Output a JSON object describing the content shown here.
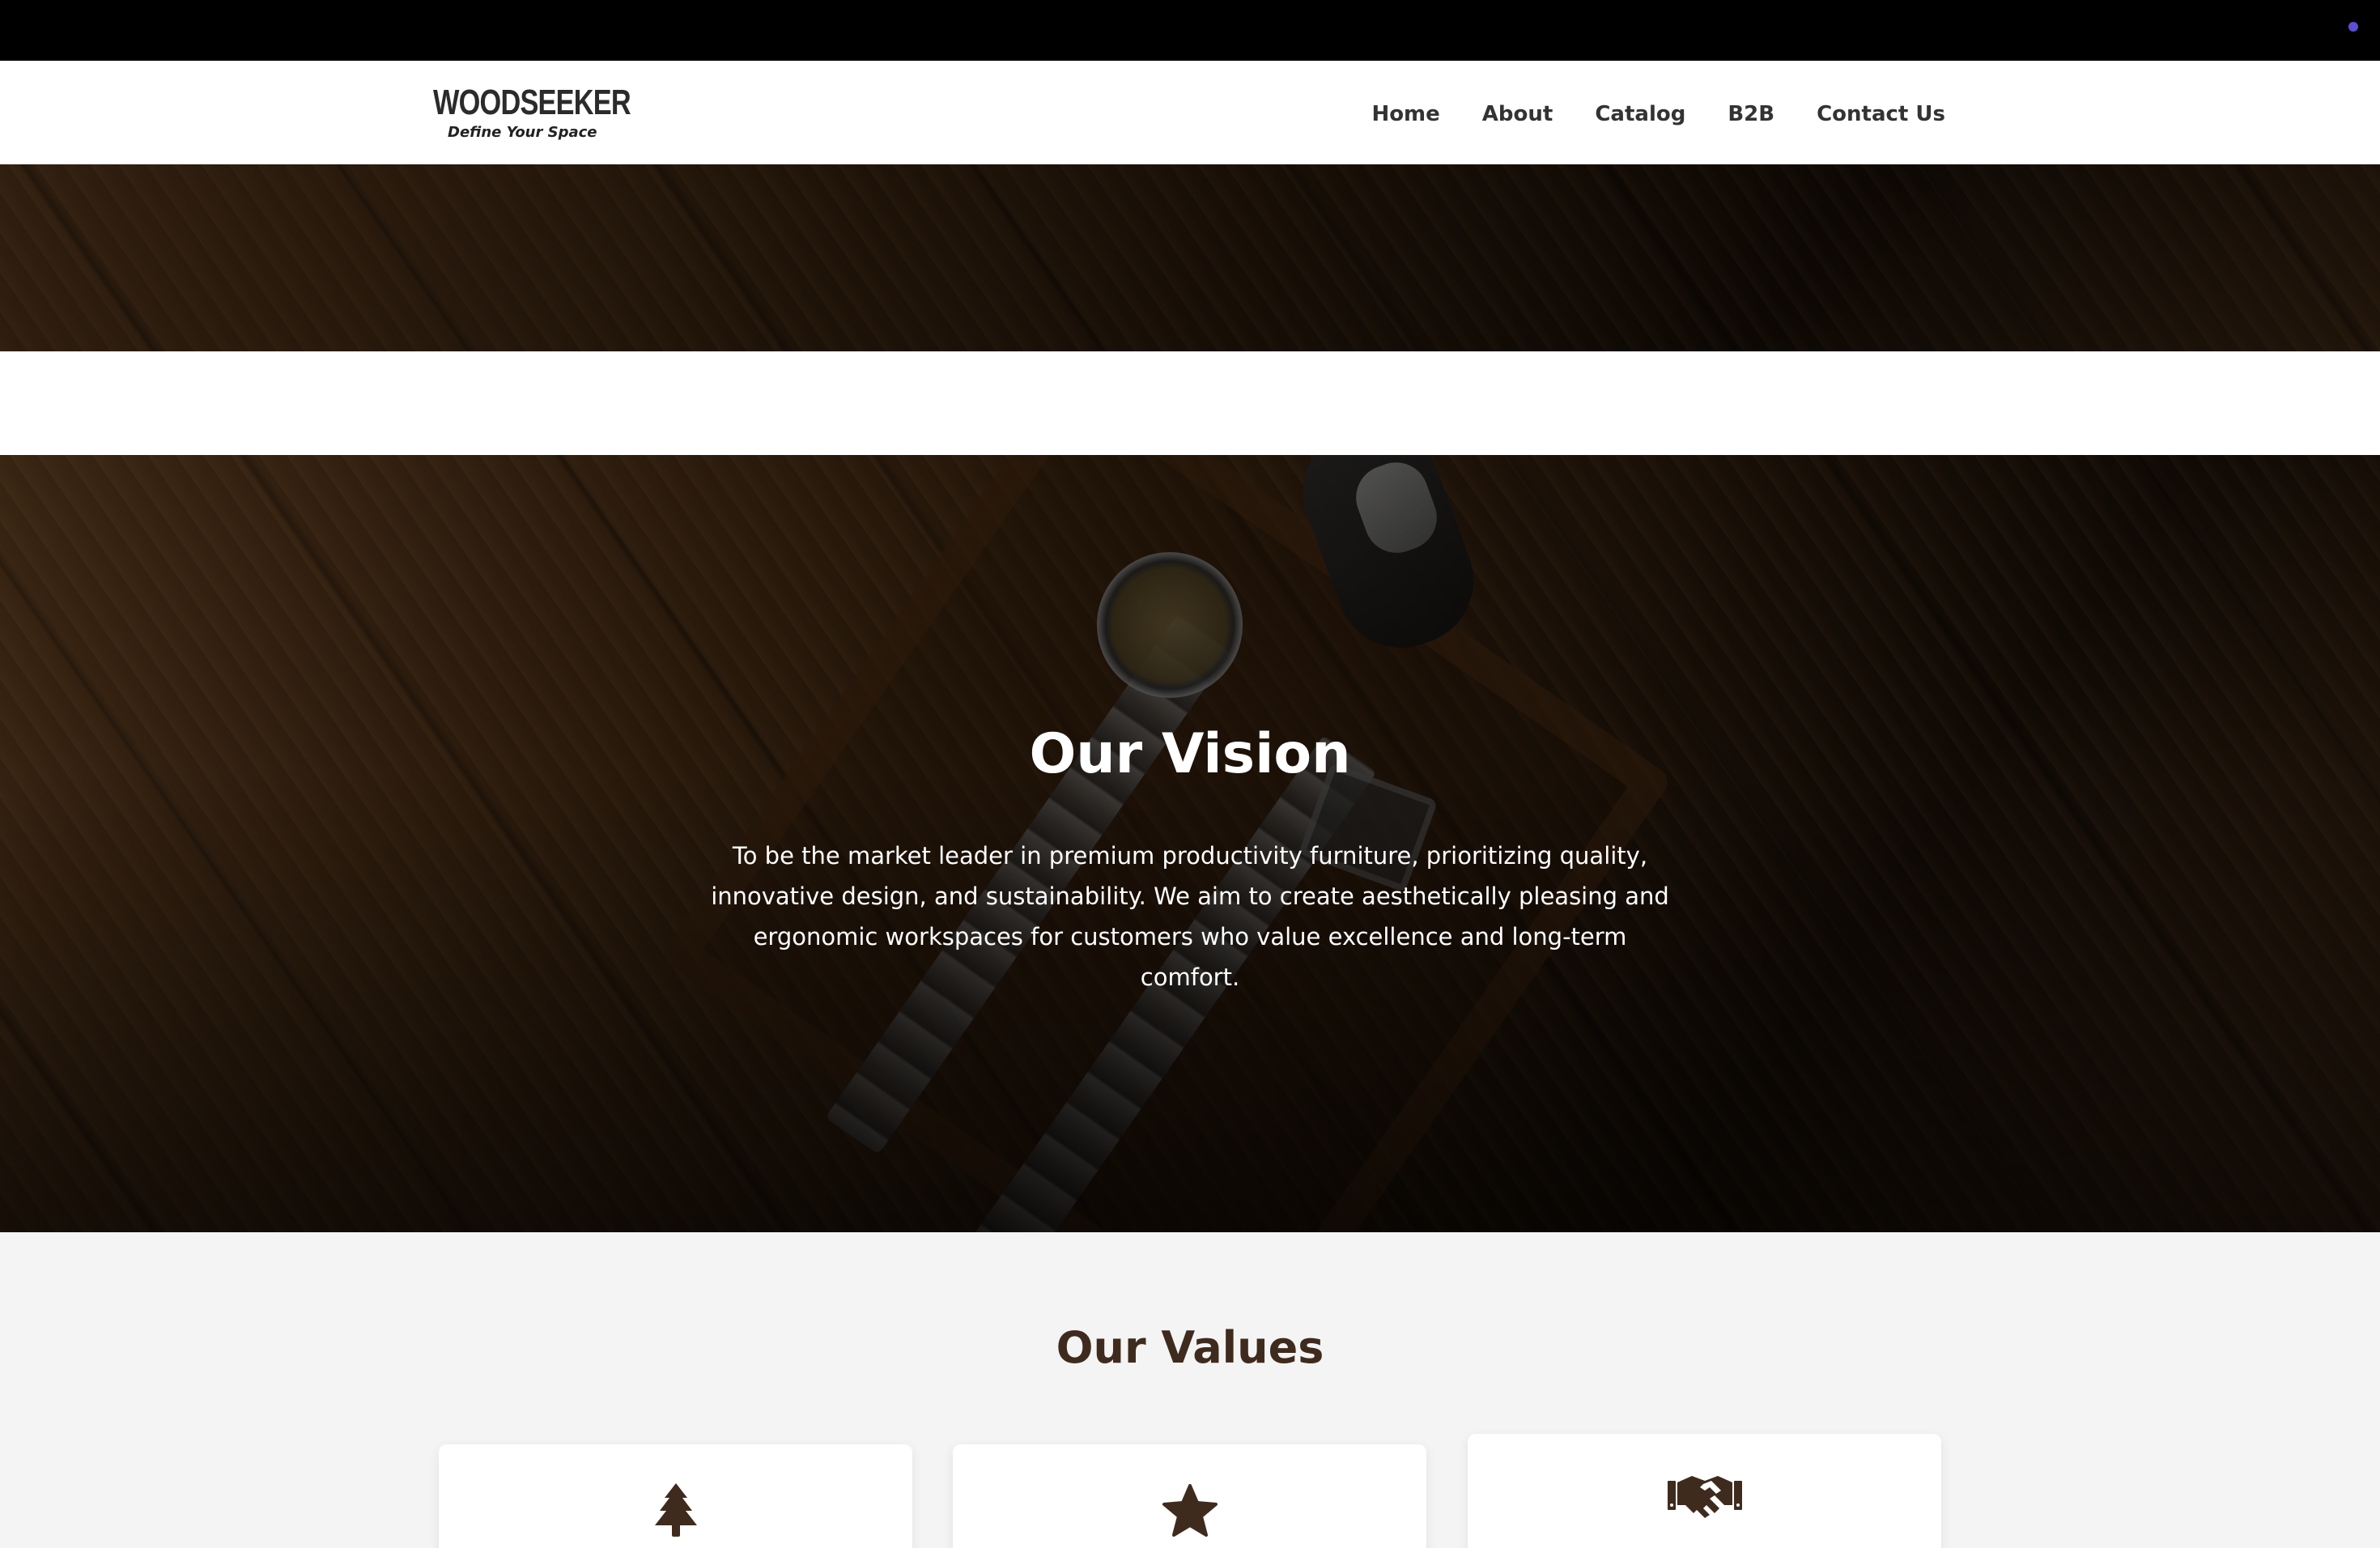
{
  "header": {
    "logo_name": "WOODSEEKER",
    "logo_tagline": "Define Your Space",
    "nav": [
      "Home",
      "About",
      "Catalog",
      "B2B",
      "Contact Us"
    ]
  },
  "vision": {
    "title": "Our Vision",
    "text": "To be the market leader in premium productivity furniture, prioritizing quality, innovative design, and sustainability. We aim to create aesthetically pleasing and ergonomic workspaces for customers who value excellence and long-term comfort."
  },
  "values": {
    "title": "Our Values",
    "cards": [
      {
        "icon": "tree-icon"
      },
      {
        "icon": "star-icon"
      },
      {
        "icon": "handshake-icon"
      }
    ]
  },
  "colors": {
    "accent_brown": "#3f2b1d",
    "topbar": "#000000",
    "indicator_dot": "#5b4fd6"
  }
}
